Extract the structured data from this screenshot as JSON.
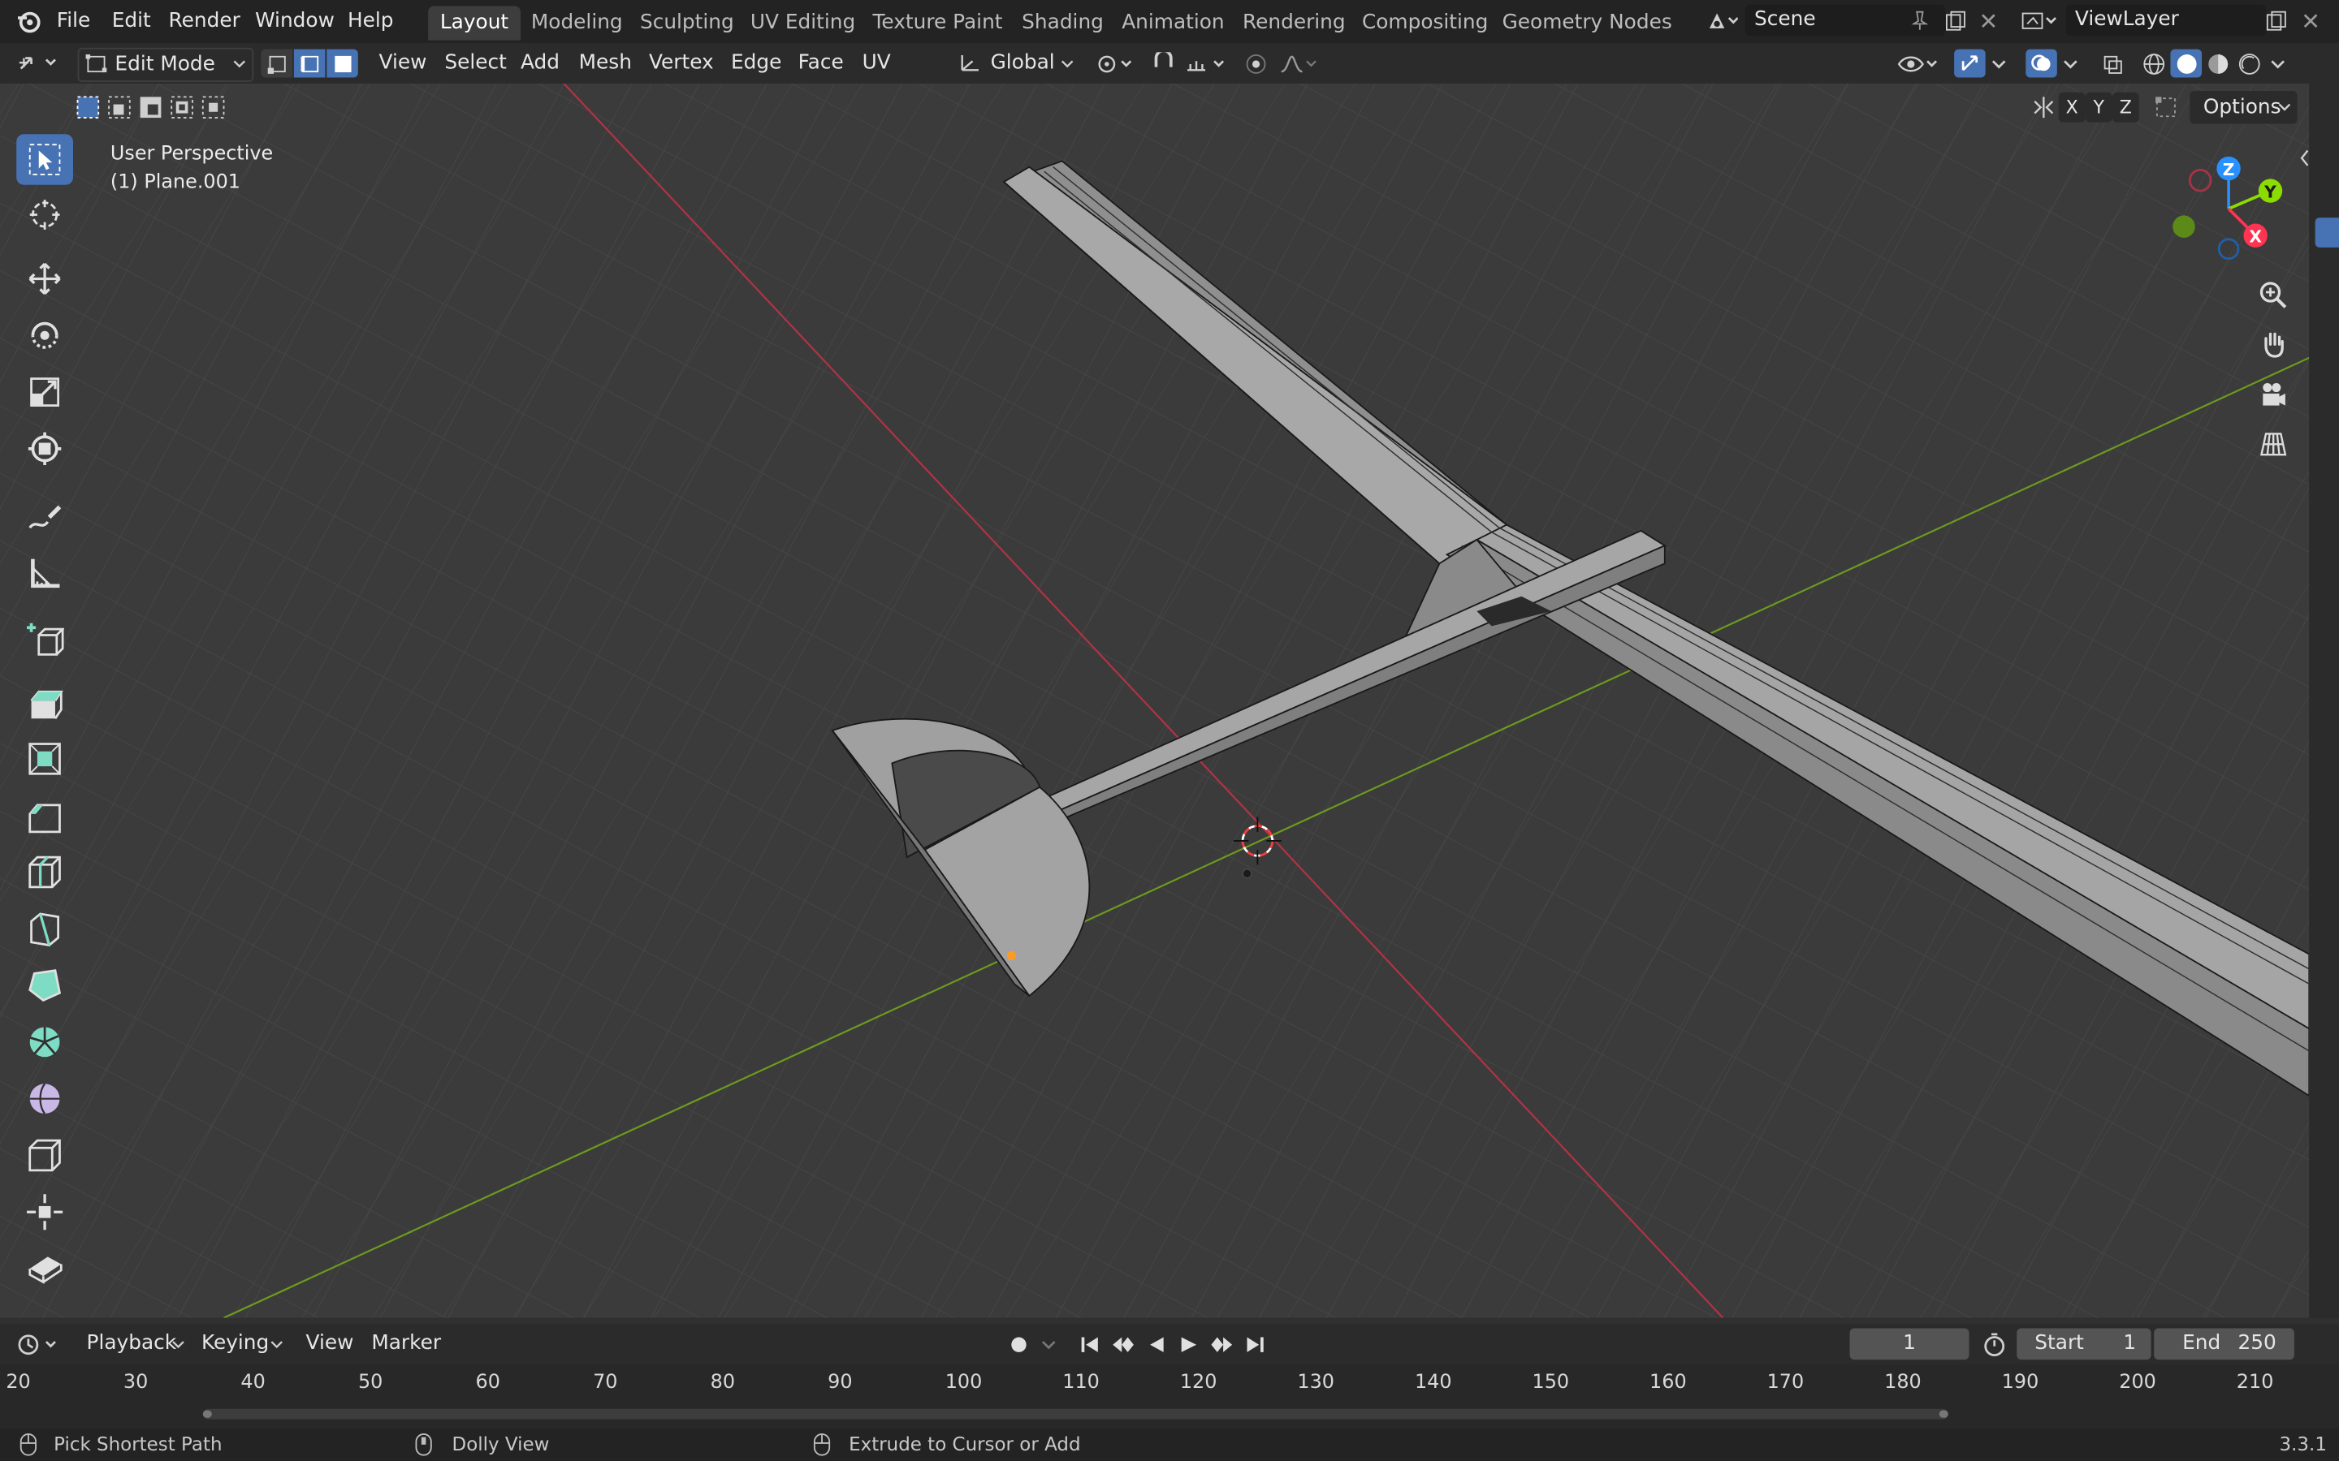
{
  "menu": {
    "file": "File",
    "edit": "Edit",
    "render": "Render",
    "window": "Window",
    "help": "Help"
  },
  "workspaces": [
    "Layout",
    "Modeling",
    "Sculpting",
    "UV Editing",
    "Texture Paint",
    "Shading",
    "Animation",
    "Rendering",
    "Compositing",
    "Geometry Nodes"
  ],
  "scene": {
    "name": "Scene"
  },
  "view_layer": {
    "name": "ViewLayer"
  },
  "viewport_header": {
    "mode": "Edit Mode",
    "menus": {
      "view": "View",
      "select": "Select",
      "add": "Add",
      "mesh": "Mesh",
      "vertex": "Vertex",
      "edge": "Edge",
      "face": "Face",
      "uv": "UV"
    },
    "transform_orientation": "Global",
    "axes": {
      "x": "X",
      "y": "Y",
      "z": "Z"
    },
    "options": "Options"
  },
  "viewport": {
    "perspective": "User Perspective",
    "object": "(1) Plane.001",
    "gizmo": {
      "z": "Z",
      "y": "Y",
      "x": "X"
    }
  },
  "timeline": {
    "playback": "Playback",
    "keying": "Keying",
    "view": "View",
    "marker": "Marker",
    "current_frame": "1",
    "start_label": "Start",
    "start_value": "1",
    "end_label": "End",
    "end_value": "250",
    "ticks": [
      "20",
      "30",
      "40",
      "50",
      "60",
      "70",
      "80",
      "90",
      "100",
      "110",
      "120",
      "130",
      "140",
      "150",
      "160",
      "170",
      "180",
      "190",
      "200",
      "210"
    ]
  },
  "status": {
    "left": "Pick Shortest Path",
    "middle": "Dolly View",
    "right": "Extrude to Cursor or Add",
    "version": "3.3.1"
  },
  "colors": {
    "accent": "#4772b3",
    "axis_x": "#ff3352",
    "axis_y": "#8bdc00",
    "axis_z": "#2890ff",
    "tool_green": "#7fdcc4"
  }
}
